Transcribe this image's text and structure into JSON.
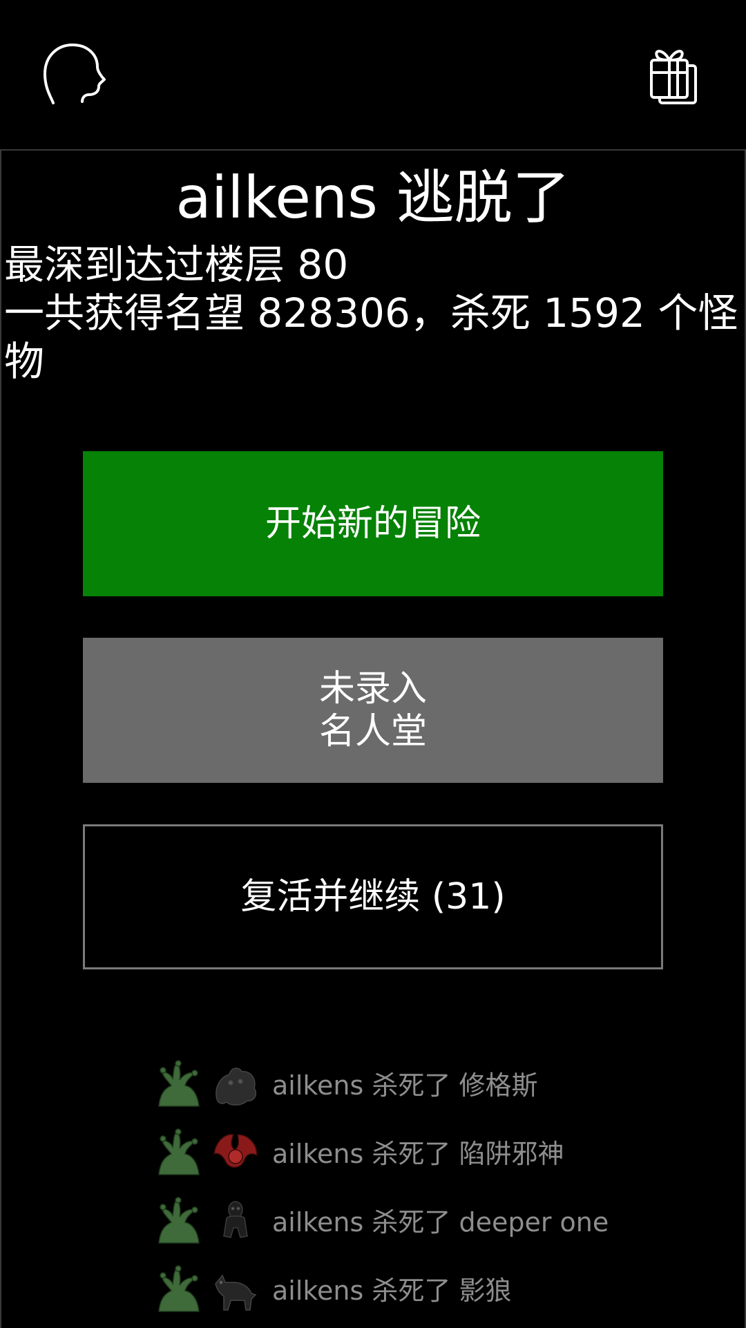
{
  "topbar": {
    "left_icon": "head-silhouette-icon",
    "right_icon": "gift-boxes-icon"
  },
  "result": {
    "title": "ailkens 逃脱了",
    "stats_line1": "最深到达过楼层 80",
    "stats_line2": "一共获得名望 828306，杀死 1592 个怪物"
  },
  "buttons": {
    "new_adventure": "开始新的冒险",
    "hall_of_fame_line1": "未录入",
    "hall_of_fame_line2": "名人堂",
    "revive": "复活并继续 (31)"
  },
  "colors": {
    "new_adventure_bg": "#068206",
    "hall_of_fame_bg": "#6b6b6b",
    "log_text": "#8e8e8e"
  },
  "kill_log": [
    {
      "text": "ailkens 杀死了 修格斯",
      "killer_icon": "hydra-icon",
      "victim_icon": "shoggoth-icon"
    },
    {
      "text": "ailkens 杀死了 陷阱邪神",
      "killer_icon": "hydra-icon",
      "victim_icon": "red-demon-icon"
    },
    {
      "text": "ailkens 杀死了 deeper one",
      "killer_icon": "hydra-icon",
      "victim_icon": "deeper-one-icon"
    },
    {
      "text": "ailkens 杀死了 影狼",
      "killer_icon": "hydra-icon",
      "victim_icon": "shadow-wolf-icon"
    }
  ]
}
